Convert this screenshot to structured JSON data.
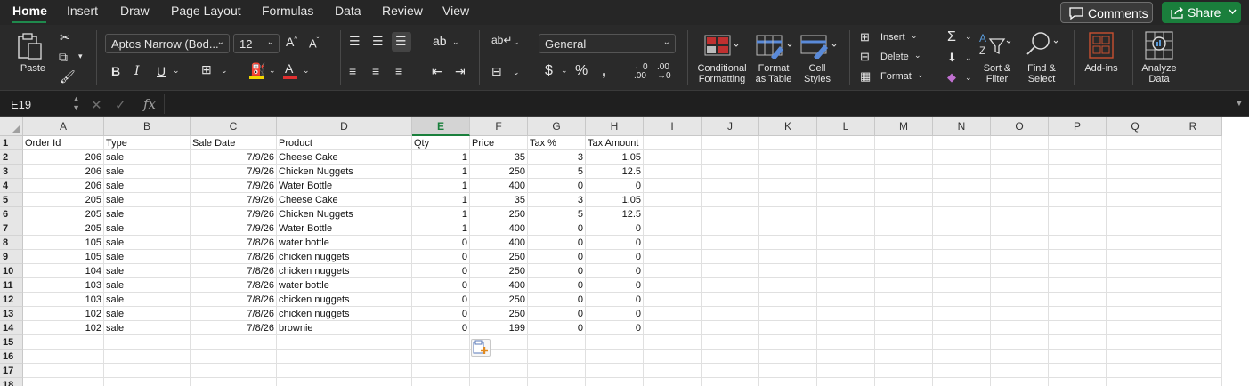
{
  "tabs": [
    "Home",
    "Insert",
    "Draw",
    "Page Layout",
    "Formulas",
    "Data",
    "Review",
    "View"
  ],
  "header_buttons": {
    "comments": "Comments",
    "share": "Share"
  },
  "ribbon": {
    "paste": "Paste",
    "font_name": "Aptos Narrow (Bod...",
    "font_size": "12",
    "number_format": "General",
    "insert": "Insert",
    "delete": "Delete",
    "format": "Format",
    "conditional_formatting": [
      "Conditional",
      "Formatting"
    ],
    "format_as_table": [
      "Format",
      "as Table"
    ],
    "cell_styles": [
      "Cell",
      "Styles"
    ],
    "sort_filter": [
      "Sort &",
      "Filter"
    ],
    "find_select": [
      "Find &",
      "Select"
    ],
    "add_ins": "Add-ins",
    "analyze_data": [
      "Analyze",
      "Data"
    ],
    "accent_fill": "#f2d600",
    "accent_font": "#e03030"
  },
  "formula_bar": {
    "name_box": "E19",
    "fx": "fx",
    "formula": ""
  },
  "sheet": {
    "selected_column": "E",
    "columns": [
      "A",
      "B",
      "C",
      "D",
      "E",
      "F",
      "G",
      "H",
      "I",
      "J",
      "K",
      "L",
      "M",
      "N",
      "O",
      "P",
      "Q",
      "R"
    ],
    "rows": [
      "1",
      "2",
      "3",
      "4",
      "5",
      "6",
      "7",
      "8",
      "9",
      "10",
      "11",
      "12",
      "13",
      "14",
      "15",
      "16",
      "17",
      "18"
    ],
    "headers": [
      "Order Id",
      "Type",
      "Sale Date",
      "Product",
      "Qty",
      "Price",
      "Tax %",
      "Tax Amount"
    ],
    "data": [
      [
        "206",
        "sale",
        "7/9/26",
        "Cheese Cake",
        "1",
        "35",
        "3",
        "1.05"
      ],
      [
        "206",
        "sale",
        "7/9/26",
        "Chicken Nuggets",
        "1",
        "250",
        "5",
        "12.5"
      ],
      [
        "206",
        "sale",
        "7/9/26",
        "Water Bottle",
        "1",
        "400",
        "0",
        "0"
      ],
      [
        "205",
        "sale",
        "7/9/26",
        "Cheese Cake",
        "1",
        "35",
        "3",
        "1.05"
      ],
      [
        "205",
        "sale",
        "7/9/26",
        "Chicken Nuggets",
        "1",
        "250",
        "5",
        "12.5"
      ],
      [
        "205",
        "sale",
        "7/9/26",
        "Water Bottle",
        "1",
        "400",
        "0",
        "0"
      ],
      [
        "105",
        "sale",
        "7/8/26",
        "water bottle",
        "0",
        "400",
        "0",
        "0"
      ],
      [
        "105",
        "sale",
        "7/8/26",
        "chicken nuggets",
        "0",
        "250",
        "0",
        "0"
      ],
      [
        "104",
        "sale",
        "7/8/26",
        "chicken nuggets",
        "0",
        "250",
        "0",
        "0"
      ],
      [
        "103",
        "sale",
        "7/8/26",
        "water bottle",
        "0",
        "400",
        "0",
        "0"
      ],
      [
        "103",
        "sale",
        "7/8/26",
        "chicken nuggets",
        "0",
        "250",
        "0",
        "0"
      ],
      [
        "102",
        "sale",
        "7/8/26",
        "chicken nuggets",
        "0",
        "250",
        "0",
        "0"
      ],
      [
        "102",
        "sale",
        "7/8/26",
        "brownie",
        "0",
        "199",
        "0",
        "0"
      ]
    ]
  }
}
